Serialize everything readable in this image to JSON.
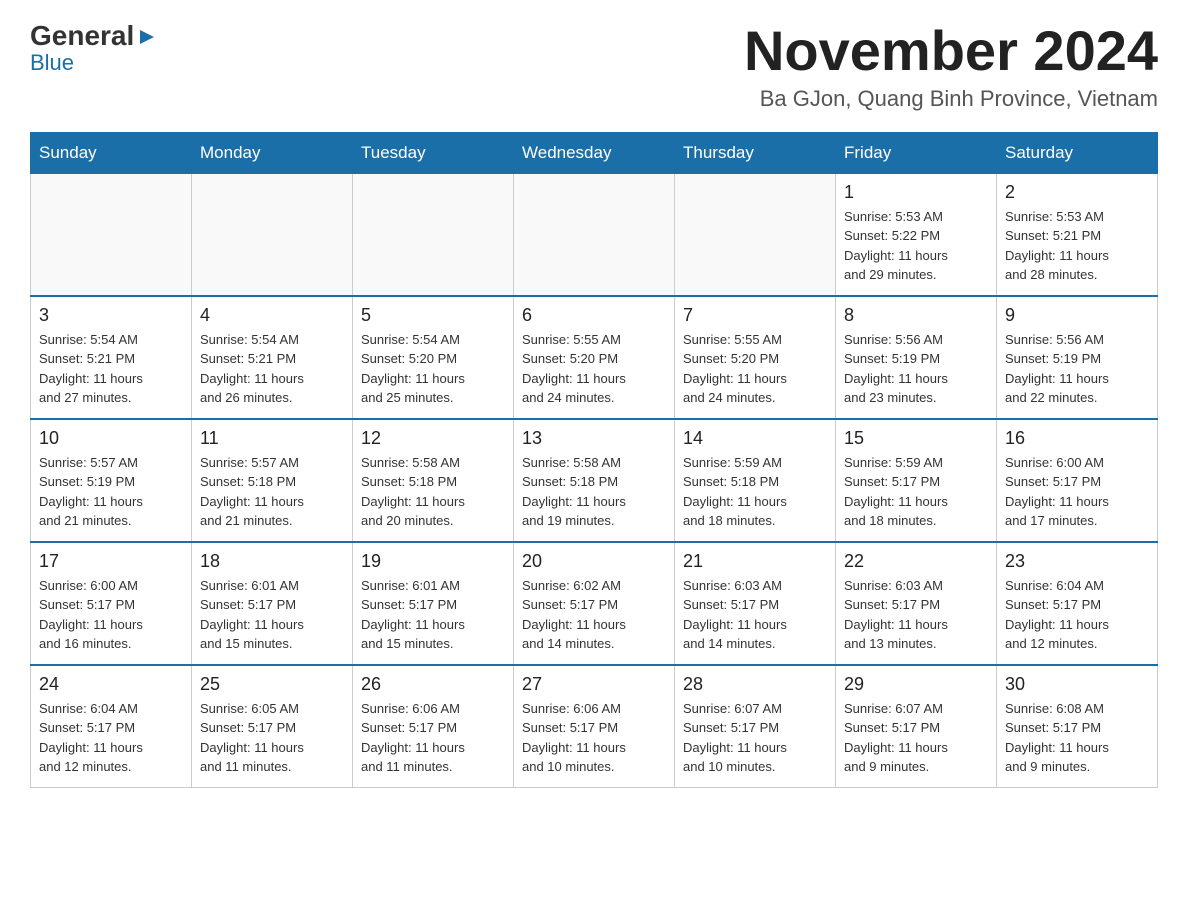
{
  "logo": {
    "general": "General",
    "blue": "Blue"
  },
  "title": "November 2024",
  "subtitle": "Ba GJon, Quang Binh Province, Vietnam",
  "weekdays": [
    "Sunday",
    "Monday",
    "Tuesday",
    "Wednesday",
    "Thursday",
    "Friday",
    "Saturday"
  ],
  "weeks": [
    [
      {
        "day": "",
        "info": ""
      },
      {
        "day": "",
        "info": ""
      },
      {
        "day": "",
        "info": ""
      },
      {
        "day": "",
        "info": ""
      },
      {
        "day": "",
        "info": ""
      },
      {
        "day": "1",
        "info": "Sunrise: 5:53 AM\nSunset: 5:22 PM\nDaylight: 11 hours\nand 29 minutes."
      },
      {
        "day": "2",
        "info": "Sunrise: 5:53 AM\nSunset: 5:21 PM\nDaylight: 11 hours\nand 28 minutes."
      }
    ],
    [
      {
        "day": "3",
        "info": "Sunrise: 5:54 AM\nSunset: 5:21 PM\nDaylight: 11 hours\nand 27 minutes."
      },
      {
        "day": "4",
        "info": "Sunrise: 5:54 AM\nSunset: 5:21 PM\nDaylight: 11 hours\nand 26 minutes."
      },
      {
        "day": "5",
        "info": "Sunrise: 5:54 AM\nSunset: 5:20 PM\nDaylight: 11 hours\nand 25 minutes."
      },
      {
        "day": "6",
        "info": "Sunrise: 5:55 AM\nSunset: 5:20 PM\nDaylight: 11 hours\nand 24 minutes."
      },
      {
        "day": "7",
        "info": "Sunrise: 5:55 AM\nSunset: 5:20 PM\nDaylight: 11 hours\nand 24 minutes."
      },
      {
        "day": "8",
        "info": "Sunrise: 5:56 AM\nSunset: 5:19 PM\nDaylight: 11 hours\nand 23 minutes."
      },
      {
        "day": "9",
        "info": "Sunrise: 5:56 AM\nSunset: 5:19 PM\nDaylight: 11 hours\nand 22 minutes."
      }
    ],
    [
      {
        "day": "10",
        "info": "Sunrise: 5:57 AM\nSunset: 5:19 PM\nDaylight: 11 hours\nand 21 minutes."
      },
      {
        "day": "11",
        "info": "Sunrise: 5:57 AM\nSunset: 5:18 PM\nDaylight: 11 hours\nand 21 minutes."
      },
      {
        "day": "12",
        "info": "Sunrise: 5:58 AM\nSunset: 5:18 PM\nDaylight: 11 hours\nand 20 minutes."
      },
      {
        "day": "13",
        "info": "Sunrise: 5:58 AM\nSunset: 5:18 PM\nDaylight: 11 hours\nand 19 minutes."
      },
      {
        "day": "14",
        "info": "Sunrise: 5:59 AM\nSunset: 5:18 PM\nDaylight: 11 hours\nand 18 minutes."
      },
      {
        "day": "15",
        "info": "Sunrise: 5:59 AM\nSunset: 5:17 PM\nDaylight: 11 hours\nand 18 minutes."
      },
      {
        "day": "16",
        "info": "Sunrise: 6:00 AM\nSunset: 5:17 PM\nDaylight: 11 hours\nand 17 minutes."
      }
    ],
    [
      {
        "day": "17",
        "info": "Sunrise: 6:00 AM\nSunset: 5:17 PM\nDaylight: 11 hours\nand 16 minutes."
      },
      {
        "day": "18",
        "info": "Sunrise: 6:01 AM\nSunset: 5:17 PM\nDaylight: 11 hours\nand 15 minutes."
      },
      {
        "day": "19",
        "info": "Sunrise: 6:01 AM\nSunset: 5:17 PM\nDaylight: 11 hours\nand 15 minutes."
      },
      {
        "day": "20",
        "info": "Sunrise: 6:02 AM\nSunset: 5:17 PM\nDaylight: 11 hours\nand 14 minutes."
      },
      {
        "day": "21",
        "info": "Sunrise: 6:03 AM\nSunset: 5:17 PM\nDaylight: 11 hours\nand 14 minutes."
      },
      {
        "day": "22",
        "info": "Sunrise: 6:03 AM\nSunset: 5:17 PM\nDaylight: 11 hours\nand 13 minutes."
      },
      {
        "day": "23",
        "info": "Sunrise: 6:04 AM\nSunset: 5:17 PM\nDaylight: 11 hours\nand 12 minutes."
      }
    ],
    [
      {
        "day": "24",
        "info": "Sunrise: 6:04 AM\nSunset: 5:17 PM\nDaylight: 11 hours\nand 12 minutes."
      },
      {
        "day": "25",
        "info": "Sunrise: 6:05 AM\nSunset: 5:17 PM\nDaylight: 11 hours\nand 11 minutes."
      },
      {
        "day": "26",
        "info": "Sunrise: 6:06 AM\nSunset: 5:17 PM\nDaylight: 11 hours\nand 11 minutes."
      },
      {
        "day": "27",
        "info": "Sunrise: 6:06 AM\nSunset: 5:17 PM\nDaylight: 11 hours\nand 10 minutes."
      },
      {
        "day": "28",
        "info": "Sunrise: 6:07 AM\nSunset: 5:17 PM\nDaylight: 11 hours\nand 10 minutes."
      },
      {
        "day": "29",
        "info": "Sunrise: 6:07 AM\nSunset: 5:17 PM\nDaylight: 11 hours\nand 9 minutes."
      },
      {
        "day": "30",
        "info": "Sunrise: 6:08 AM\nSunset: 5:17 PM\nDaylight: 11 hours\nand 9 minutes."
      }
    ]
  ]
}
